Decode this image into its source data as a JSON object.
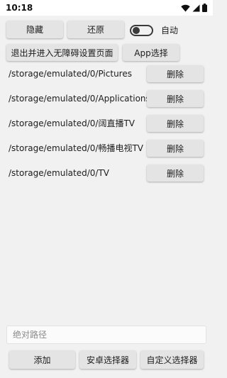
{
  "status_bar": {
    "time": "10:18"
  },
  "top_row": {
    "hide_label": "隐藏",
    "restore_label": "还原",
    "auto_label": "自动",
    "auto_enabled": false
  },
  "second_row": {
    "accessibility_label": "退出并进入无障碍设置页面",
    "app_select_label": "App选择"
  },
  "paths": [
    {
      "path": "/storage/emulated/0/Pictures",
      "delete_label": "删除"
    },
    {
      "path": "/storage/emulated/0/Applications",
      "delete_label": "删除"
    },
    {
      "path": "/storage/emulated/0/阔直播TV",
      "delete_label": "删除"
    },
    {
      "path": "/storage/emulated/0/畅播电视TV",
      "delete_label": "删除"
    },
    {
      "path": "/storage/emulated/0/TV",
      "delete_label": "删除"
    }
  ],
  "path_input": {
    "value": "",
    "placeholder": "绝对路径"
  },
  "bottom_row": {
    "add_label": "添加",
    "android_picker_label": "安卓选择器",
    "custom_picker_label": "自定义选择器"
  }
}
